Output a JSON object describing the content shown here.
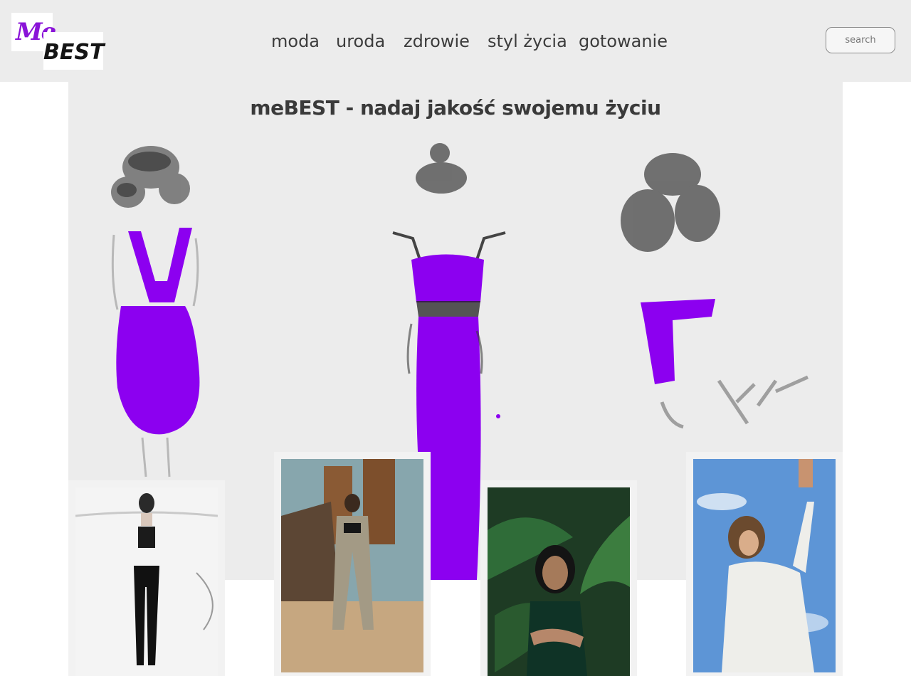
{
  "logo": {
    "top": "Me",
    "bottom": "BEST"
  },
  "nav": [
    "moda",
    "uroda",
    "zdrowie",
    "styl życia",
    "gotowanie"
  ],
  "search": {
    "placeholder": "search"
  },
  "hero": {
    "title": "meBEST - nadaj jakość swojemu życiu"
  },
  "colors": {
    "accent": "#8a14d8",
    "background": "#ececec",
    "text": "#3c3c3c"
  }
}
